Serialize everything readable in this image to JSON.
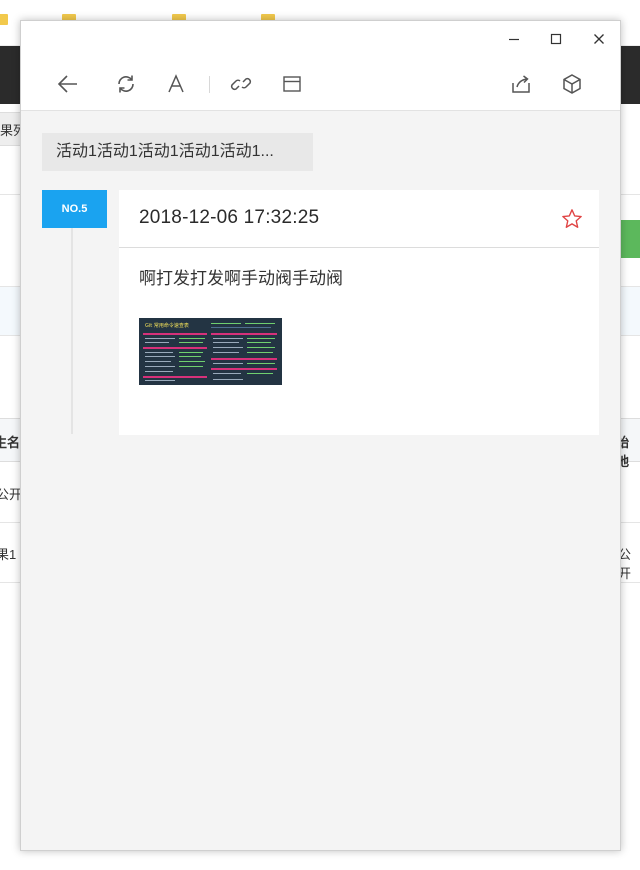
{
  "background_app": {
    "left_tab_label": "果列",
    "header_cells": {
      "left": "生名",
      "right": "始地"
    },
    "row1": {
      "left": "公开"
    },
    "row2": {
      "left": "果1",
      "right": "公开"
    },
    "topbar_color": "#2b2b2b",
    "accent_green": "#5cb85c"
  },
  "window": {
    "controls": [
      "minimize-icon",
      "maximize-icon",
      "close-icon"
    ]
  },
  "toolbar": {
    "left_tools": [
      "back-arrow-icon",
      "refresh-icon",
      "font-size-icon",
      "link-icon",
      "window-icon"
    ],
    "right_tools": [
      "share-icon",
      "cube-icon"
    ]
  },
  "activity": {
    "tag_text": "活动1活动1活动1活动1活动1...",
    "badge": "NO.5",
    "badge_color": "#1aa3f0",
    "date": "2018-12-06 17:32:25",
    "star_color": "#e04444",
    "body_text": "啊打发打发啊手动阀手动阀",
    "image_title": "Git 常用命令速查表"
  }
}
